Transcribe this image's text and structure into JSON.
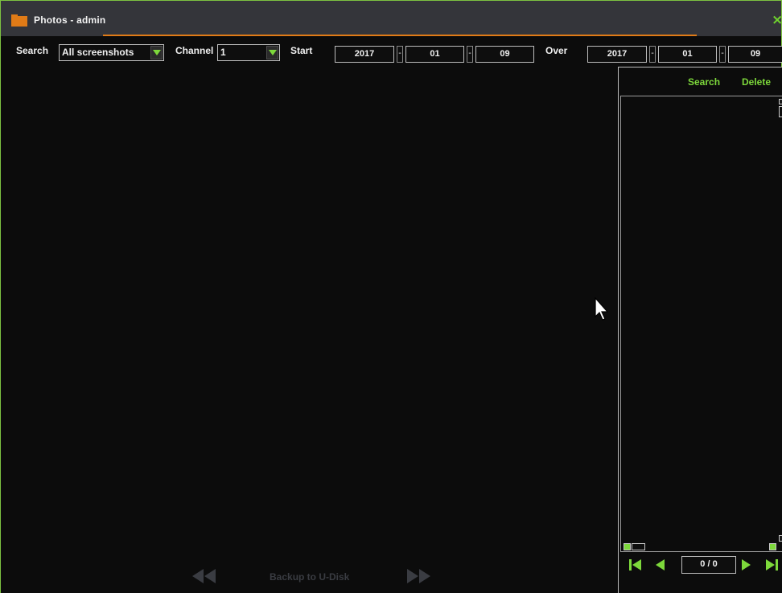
{
  "window": {
    "title": "Photos - admin",
    "close_symbol": "×",
    "colors": {
      "accent_green": "#7dd83b",
      "accent_orange": "#e07b17",
      "titlebar": "#34353a",
      "background": "#0c0c0c"
    },
    "icons": {
      "title": "folder-icon",
      "close": "close-icon"
    }
  },
  "toolbar": {
    "search_label": "Search",
    "search_type": {
      "value": "All screenshots",
      "icon": "chevron-down-icon"
    },
    "channel_label": "Channel",
    "channel": {
      "value": "1",
      "icon": "chevron-down-icon"
    },
    "start_label": "Start",
    "start_date": {
      "year": "2017",
      "month": "01",
      "day": "09"
    },
    "over_label": "Over",
    "end_date": {
      "year": "2017",
      "month": "01",
      "day": "09"
    },
    "date_separator": "-"
  },
  "right_panel": {
    "search_label": "Search",
    "delete_label": "Delete",
    "page_counter": "0 / 0",
    "icons": {
      "first": "skip-first-icon",
      "prev": "prev-icon",
      "next": "next-icon",
      "last": "skip-last-icon"
    }
  },
  "bottom": {
    "backup_label": "Backup to U-Disk",
    "icons": {
      "rewind": "rewind-icon",
      "fast_forward": "fast-forward-icon"
    }
  }
}
